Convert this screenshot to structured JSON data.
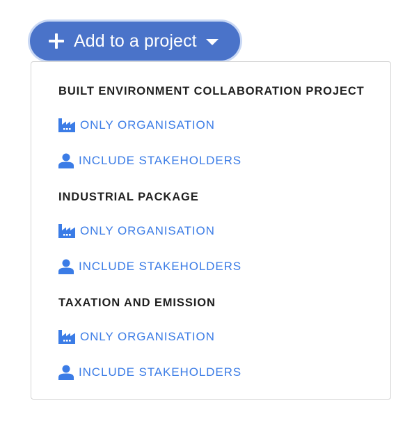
{
  "add_button": {
    "label": "Add to a project",
    "plus_icon": "plus-icon",
    "caret_icon": "caret-down-icon"
  },
  "colors": {
    "button_bg": "#4a73c9",
    "button_ring": "#c9d8f4",
    "link": "#3b7ce6",
    "heading": "#1f1f1f",
    "panel_border": "#d4d4d4"
  },
  "projects": [
    {
      "title": "BUILT ENVIRONMENT COLLABORATION PROJECT",
      "options": [
        {
          "label": "ONLY ORGANISATION",
          "icon": "factory-icon"
        },
        {
          "label": "INCLUDE STAKEHOLDERS",
          "icon": "person-icon"
        }
      ]
    },
    {
      "title": "INDUSTRIAL PACKAGE",
      "options": [
        {
          "label": "ONLY ORGANISATION",
          "icon": "factory-icon"
        },
        {
          "label": "INCLUDE STAKEHOLDERS",
          "icon": "person-icon"
        }
      ]
    },
    {
      "title": "TAXATION AND EMISSION",
      "options": [
        {
          "label": "ONLY ORGANISATION",
          "icon": "factory-icon"
        },
        {
          "label": "INCLUDE STAKEHOLDERS",
          "icon": "person-icon"
        }
      ]
    }
  ]
}
